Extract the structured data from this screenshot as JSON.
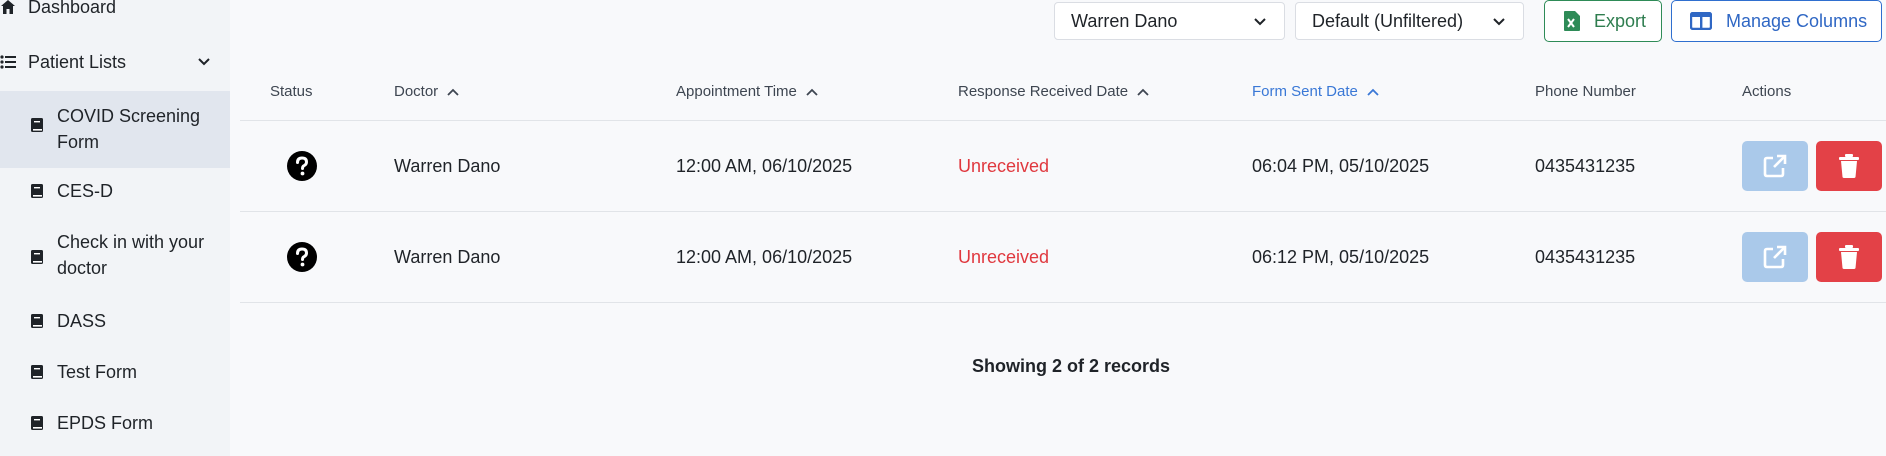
{
  "sidebar": {
    "dashboard": "Dashboard",
    "patient_lists": "Patient Lists",
    "items": [
      {
        "label": "COVID Screening Form",
        "active": true
      },
      {
        "label": "CES-D",
        "active": false
      },
      {
        "label": "Check in with your doctor",
        "active": false
      },
      {
        "label": "DASS",
        "active": false
      },
      {
        "label": "Test Form",
        "active": false
      },
      {
        "label": "EPDS Form",
        "active": false
      }
    ]
  },
  "toolbar": {
    "doctor_select": "Warren Dano",
    "filter_select": "Default (Unfiltered)",
    "export_label": "Export",
    "manage_columns_label": "Manage Columns"
  },
  "table": {
    "columns": [
      "Status",
      "Doctor",
      "Appointment Time",
      "Response Received Date",
      "Form Sent Date",
      "Phone Number",
      "Actions"
    ],
    "rows": [
      {
        "status": "unknown",
        "doctor": "Warren Dano",
        "appointment": "12:00 AM, 06/10/2025",
        "response": "Unreceived",
        "sent": "06:04 PM, 05/10/2025",
        "phone": "0435431235"
      },
      {
        "status": "unknown",
        "doctor": "Warren Dano",
        "appointment": "12:00 AM, 06/10/2025",
        "response": "Unreceived",
        "sent": "06:12 PM, 05/10/2025",
        "phone": "0435431235"
      }
    ]
  },
  "footer": {
    "records_text": "Showing 2 of 2 records"
  },
  "colors": {
    "accent_blue": "#3a78d6",
    "danger_red": "#e0383e",
    "export_green": "#2e8b57"
  }
}
